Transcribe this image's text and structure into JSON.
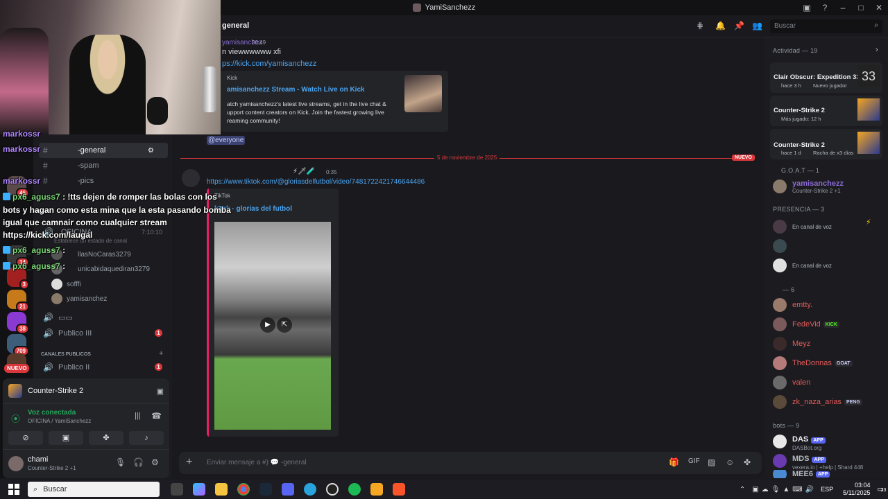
{
  "window": {
    "title": "YamiSanchezz"
  },
  "search": {
    "placeholder": "Buscar"
  },
  "channel": {
    "header_name": "general"
  },
  "servers": [
    {
      "badge": "46"
    },
    {
      "badge": "14"
    },
    {
      "badge": "3"
    },
    {
      "badge": "21"
    },
    {
      "badge": "38"
    },
    {
      "badge": "709"
    },
    {
      "label": "NUEVO"
    }
  ],
  "channels": {
    "general": "-general",
    "spam": "-spam",
    "pics": "-pics",
    "voice_oficina": "OFICINA",
    "voice_status": "Establece un estado de canal",
    "voice_timer": "7:10:10",
    "voice_users": [
      "llasNoCaras3279",
      "unicabidaquediran3279",
      "sofffi",
      "yamisanchez"
    ],
    "misc_voice": "▭▭",
    "publico_iii": "Publico III",
    "publico_iii_badge": "1",
    "category_public": "CANALES PUBLICOS",
    "publico_ii": "Publico II",
    "publico_ii_badge": "1"
  },
  "activity_panel": {
    "game": "Counter-Strike 2",
    "voice_status": "Voz conectada",
    "voice_path": "OFICINA / YamiSanchezz",
    "user_name": "chami",
    "user_status": "Counter-Strike 2 +1"
  },
  "messages": {
    "first_author": "yamisanchez",
    "first_time": "20:49",
    "first_text": "n viewwwwww xfi",
    "first_link": "ps://kick.com/yamisanchezz",
    "embed_site": "Kick",
    "embed_title": "amisanchezz Stream - Watch Live on Kick",
    "embed_desc": "atch yamisanchezz's latest live streams, get in the live chat & upport content creators on Kick. Join the fastest growing live reaming community!",
    "everyone": "@everyone",
    "date_divider": "5 de noviembre de 2025",
    "new_label": "NUEVO",
    "second_time": "0:35",
    "tiktok_link": "https://www.tiktok.com/@gloriasdelfutbol/video/7481722421746644486",
    "tiktok_site": "TikTok",
    "tiktok_title": "kTok · glorias del futbol"
  },
  "composer": {
    "placeholder": "Enviar mensaje a #) 💬 -general"
  },
  "members": {
    "activity_header": "Actividad — 19",
    "activity_cards": [
      {
        "title": "Clair Obscur: Expedition 33",
        "sub1": "hace 3 h",
        "sub2": "Nuevo jugador"
      },
      {
        "title": "Counter-Strike 2",
        "sub1": "Más jugado: 12 h",
        "sub2": ""
      },
      {
        "title": "Counter-Strike 2",
        "sub1": "hace 1 d",
        "sub2": "Racha de x3 días"
      }
    ],
    "goat_header": "G.O.A.T — 1",
    "goat_member": {
      "name": "yamisanchezz",
      "status": "Counter-Strike 2 +1"
    },
    "presence_header": "PRESENCIA — 3",
    "presence_rows": [
      "En canal de voz",
      "",
      "En canal de voz"
    ],
    "group_header": "— 6",
    "group_members": [
      {
        "name": "emtty.",
        "tag": ""
      },
      {
        "name": "FedeVid",
        "tag": "KICK"
      },
      {
        "name": "Meyz",
        "tag": ""
      },
      {
        "name": "TheDonnas",
        "tag": "GOAT"
      },
      {
        "name": "valen",
        "tag": ""
      },
      {
        "name": "zk_naza_arias",
        "tag": "PENG"
      }
    ],
    "bots_header": "bots — 9",
    "bots": [
      {
        "name": "DAS",
        "tag": "APP",
        "sub": "DASBot.org"
      },
      {
        "name": "MDS",
        "tag": "APP",
        "sub": "vexera.io | +help | Shard 448"
      },
      {
        "name": "MEE6",
        "tag": "APP",
        "sub": ""
      }
    ]
  },
  "stream_chat": {
    "users": [
      "markossr",
      "markossr",
      "markossr"
    ],
    "msg1_user": "px6_aguss7",
    "msg1_text": ": !tts dejen de romper las bolas con los",
    "msg1_line2": "bots y hagan como esta mina que la esta pasando bomba",
    "msg1_line3": "igual que camnair como cualquier stream",
    "msg1_line4": "https://kick.com/laugal",
    "msg2_user": "px6_aguss7",
    "msg2_text": ":",
    "msg3_user": "px6_aguss7",
    "msg3_text": ":"
  },
  "taskbar": {
    "search": "Buscar",
    "lang": "ESP",
    "time": "03:04",
    "date": "5/11/2025",
    "notif": "23"
  },
  "colors": {
    "accent_red": "#da373c",
    "link_blue": "#4aa3ef",
    "embed_pink": "#e91e63",
    "kick_green": "#53fc18",
    "app_blue": "#5865f2"
  }
}
